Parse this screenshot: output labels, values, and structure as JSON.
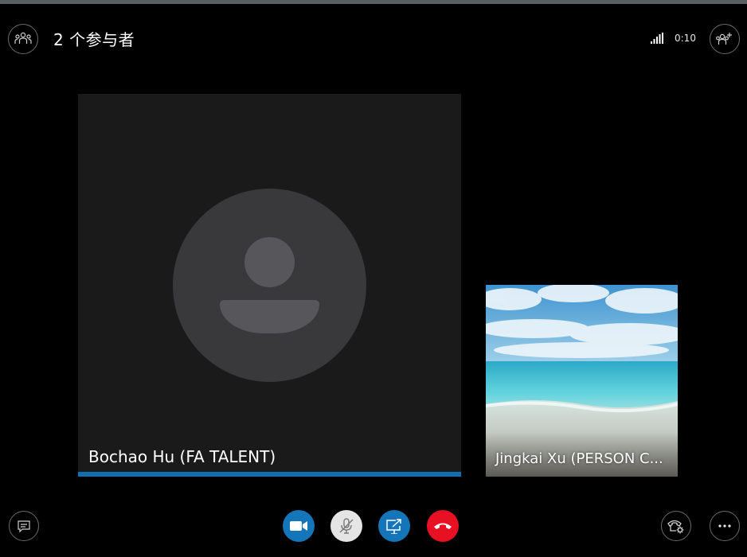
{
  "header": {
    "title": "2 个参与者",
    "call_timer": "0:10"
  },
  "participants": [
    {
      "name": "Bochao Hu (FA TALENT)",
      "video": false,
      "speaking": true
    },
    {
      "name": "Jingkai Xu (PERSON C...",
      "video": true
    }
  ],
  "icons": {
    "participants": "people-group-icon",
    "signal": "signal-strength-icon",
    "add_people": "add-people-icon",
    "chat": "chat-icon",
    "video": "video-camera-icon",
    "mute": "microphone-muted-icon",
    "share": "share-screen-icon",
    "hangup": "hang-up-icon",
    "call_settings": "call-settings-icon",
    "more": "more-options-icon"
  },
  "colors": {
    "background": "#000000",
    "video_button": "#1475b8",
    "mute_button": "#e5e5e5",
    "share_button": "#1475b8",
    "hangup_button": "#e81123",
    "active_speaker": "#0f6fb1"
  }
}
